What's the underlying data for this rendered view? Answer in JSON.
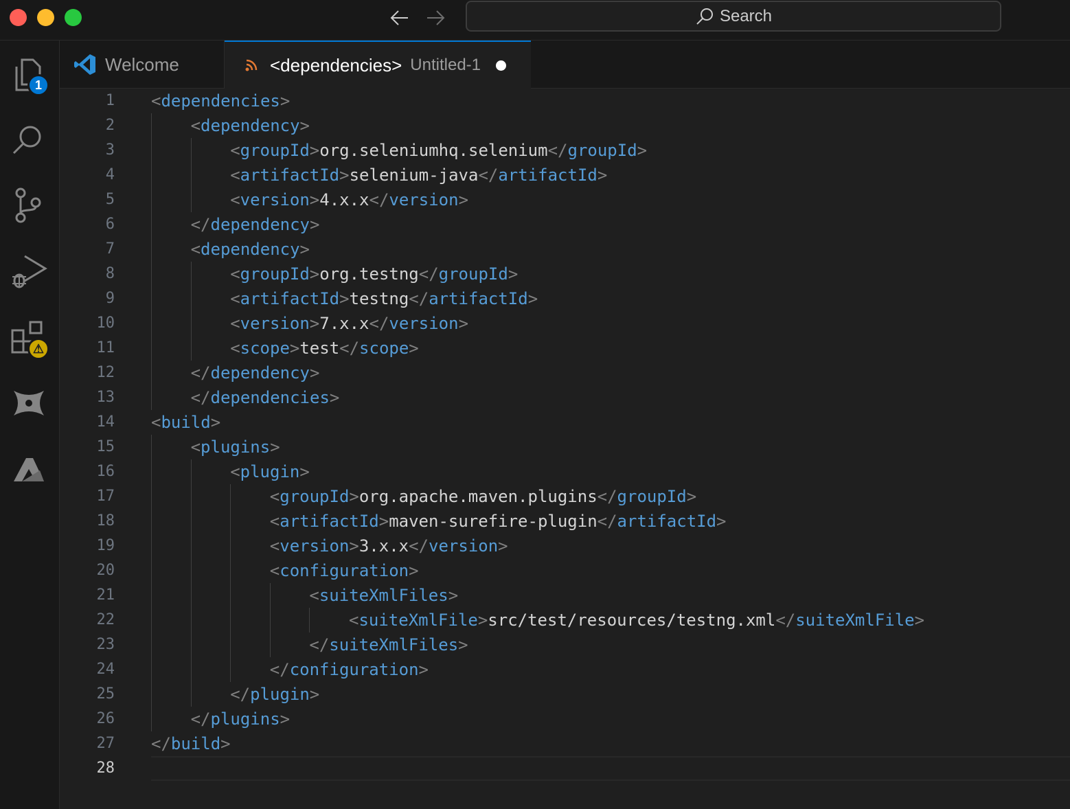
{
  "titlebar": {
    "search_label": "Search"
  },
  "activity_bar": {
    "explorer_badge": "1",
    "extensions_badge": "⚠"
  },
  "tabs": [
    {
      "label": "Welcome"
    },
    {
      "label": "<dependencies>",
      "description": "Untitled-1"
    }
  ],
  "editor": {
    "lines": [
      {
        "n": "1",
        "indent": 0,
        "tokens": [
          [
            "p",
            "<"
          ],
          [
            "t",
            "dependencies"
          ],
          [
            "p",
            ">"
          ]
        ]
      },
      {
        "n": "2",
        "indent": 1,
        "tokens": [
          [
            "p",
            "<"
          ],
          [
            "t",
            "dependency"
          ],
          [
            "p",
            ">"
          ]
        ]
      },
      {
        "n": "3",
        "indent": 2,
        "tokens": [
          [
            "p",
            "<"
          ],
          [
            "t",
            "groupId"
          ],
          [
            "p",
            ">"
          ],
          [
            "x",
            "org.seleniumhq.selenium"
          ],
          [
            "p",
            "</"
          ],
          [
            "t",
            "groupId"
          ],
          [
            "p",
            ">"
          ]
        ]
      },
      {
        "n": "4",
        "indent": 2,
        "tokens": [
          [
            "p",
            "<"
          ],
          [
            "t",
            "artifactId"
          ],
          [
            "p",
            ">"
          ],
          [
            "x",
            "selenium-java"
          ],
          [
            "p",
            "</"
          ],
          [
            "t",
            "artifactId"
          ],
          [
            "p",
            ">"
          ]
        ]
      },
      {
        "n": "5",
        "indent": 2,
        "tokens": [
          [
            "p",
            "<"
          ],
          [
            "t",
            "version"
          ],
          [
            "p",
            ">"
          ],
          [
            "x",
            "4.x.x"
          ],
          [
            "p",
            "</"
          ],
          [
            "t",
            "version"
          ],
          [
            "p",
            ">"
          ]
        ]
      },
      {
        "n": "6",
        "indent": 1,
        "tokens": [
          [
            "p",
            "</"
          ],
          [
            "t",
            "dependency"
          ],
          [
            "p",
            ">"
          ]
        ]
      },
      {
        "n": "7",
        "indent": 1,
        "tokens": [
          [
            "p",
            "<"
          ],
          [
            "t",
            "dependency"
          ],
          [
            "p",
            ">"
          ]
        ]
      },
      {
        "n": "8",
        "indent": 2,
        "tokens": [
          [
            "p",
            "<"
          ],
          [
            "t",
            "groupId"
          ],
          [
            "p",
            ">"
          ],
          [
            "x",
            "org.testng"
          ],
          [
            "p",
            "</"
          ],
          [
            "t",
            "groupId"
          ],
          [
            "p",
            ">"
          ]
        ]
      },
      {
        "n": "9",
        "indent": 2,
        "tokens": [
          [
            "p",
            "<"
          ],
          [
            "t",
            "artifactId"
          ],
          [
            "p",
            ">"
          ],
          [
            "x",
            "testng"
          ],
          [
            "p",
            "</"
          ],
          [
            "t",
            "artifactId"
          ],
          [
            "p",
            ">"
          ]
        ]
      },
      {
        "n": "10",
        "indent": 2,
        "tokens": [
          [
            "p",
            "<"
          ],
          [
            "t",
            "version"
          ],
          [
            "p",
            ">"
          ],
          [
            "x",
            "7.x.x"
          ],
          [
            "p",
            "</"
          ],
          [
            "t",
            "version"
          ],
          [
            "p",
            ">"
          ]
        ]
      },
      {
        "n": "11",
        "indent": 2,
        "tokens": [
          [
            "p",
            "<"
          ],
          [
            "t",
            "scope"
          ],
          [
            "p",
            ">"
          ],
          [
            "x",
            "test"
          ],
          [
            "p",
            "</"
          ],
          [
            "t",
            "scope"
          ],
          [
            "p",
            ">"
          ]
        ]
      },
      {
        "n": "12",
        "indent": 1,
        "tokens": [
          [
            "p",
            "</"
          ],
          [
            "t",
            "dependency"
          ],
          [
            "p",
            ">"
          ]
        ]
      },
      {
        "n": "13",
        "indent": 1,
        "tokens": [
          [
            "p",
            "</"
          ],
          [
            "t",
            "dependencies"
          ],
          [
            "p",
            ">"
          ]
        ]
      },
      {
        "n": "14",
        "indent": 0,
        "tokens": [
          [
            "p",
            "<"
          ],
          [
            "t",
            "build"
          ],
          [
            "p",
            ">"
          ]
        ]
      },
      {
        "n": "15",
        "indent": 1,
        "tokens": [
          [
            "p",
            "<"
          ],
          [
            "t",
            "plugins"
          ],
          [
            "p",
            ">"
          ]
        ]
      },
      {
        "n": "16",
        "indent": 2,
        "tokens": [
          [
            "p",
            "<"
          ],
          [
            "t",
            "plugin"
          ],
          [
            "p",
            ">"
          ]
        ]
      },
      {
        "n": "17",
        "indent": 3,
        "tokens": [
          [
            "p",
            "<"
          ],
          [
            "t",
            "groupId"
          ],
          [
            "p",
            ">"
          ],
          [
            "x",
            "org.apache.maven.plugins"
          ],
          [
            "p",
            "</"
          ],
          [
            "t",
            "groupId"
          ],
          [
            "p",
            ">"
          ]
        ]
      },
      {
        "n": "18",
        "indent": 3,
        "tokens": [
          [
            "p",
            "<"
          ],
          [
            "t",
            "artifactId"
          ],
          [
            "p",
            ">"
          ],
          [
            "x",
            "maven-surefire-plugin"
          ],
          [
            "p",
            "</"
          ],
          [
            "t",
            "artifactId"
          ],
          [
            "p",
            ">"
          ]
        ]
      },
      {
        "n": "19",
        "indent": 3,
        "tokens": [
          [
            "p",
            "<"
          ],
          [
            "t",
            "version"
          ],
          [
            "p",
            ">"
          ],
          [
            "x",
            "3.x.x"
          ],
          [
            "p",
            "</"
          ],
          [
            "t",
            "version"
          ],
          [
            "p",
            ">"
          ]
        ]
      },
      {
        "n": "20",
        "indent": 3,
        "tokens": [
          [
            "p",
            "<"
          ],
          [
            "t",
            "configuration"
          ],
          [
            "p",
            ">"
          ]
        ]
      },
      {
        "n": "21",
        "indent": 4,
        "tokens": [
          [
            "p",
            "<"
          ],
          [
            "t",
            "suiteXmlFiles"
          ],
          [
            "p",
            ">"
          ]
        ]
      },
      {
        "n": "22",
        "indent": 5,
        "tokens": [
          [
            "p",
            "<"
          ],
          [
            "t",
            "suiteXmlFile"
          ],
          [
            "p",
            ">"
          ],
          [
            "x",
            "src/test/resources/testng.xml"
          ],
          [
            "p",
            "</"
          ],
          [
            "t",
            "suiteXmlFile"
          ],
          [
            "p",
            ">"
          ]
        ]
      },
      {
        "n": "23",
        "indent": 4,
        "tokens": [
          [
            "p",
            "</"
          ],
          [
            "t",
            "suiteXmlFiles"
          ],
          [
            "p",
            ">"
          ]
        ]
      },
      {
        "n": "24",
        "indent": 3,
        "tokens": [
          [
            "p",
            "</"
          ],
          [
            "t",
            "configuration"
          ],
          [
            "p",
            ">"
          ]
        ]
      },
      {
        "n": "25",
        "indent": 2,
        "tokens": [
          [
            "p",
            "</"
          ],
          [
            "t",
            "plugin"
          ],
          [
            "p",
            ">"
          ]
        ]
      },
      {
        "n": "26",
        "indent": 1,
        "tokens": [
          [
            "p",
            "</"
          ],
          [
            "t",
            "plugins"
          ],
          [
            "p",
            ">"
          ]
        ]
      },
      {
        "n": "27",
        "indent": 0,
        "tokens": [
          [
            "p",
            "</"
          ],
          [
            "t",
            "build"
          ],
          [
            "p",
            ">"
          ]
        ]
      },
      {
        "n": "28",
        "indent": 0,
        "tokens": []
      }
    ],
    "current_line": "28"
  }
}
